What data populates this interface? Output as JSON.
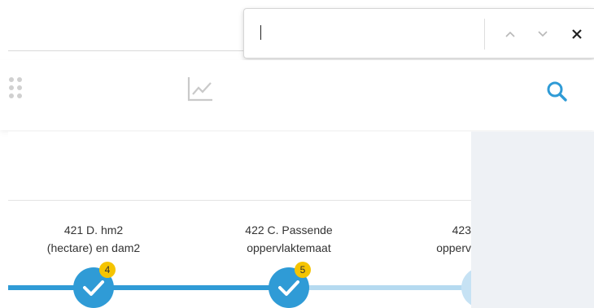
{
  "find_bar": {
    "value": "",
    "icons": {
      "prev": "chevron-up-icon",
      "next": "chevron-down-icon",
      "close": "close-icon"
    }
  },
  "toolbar": {
    "icons": [
      "apps-grid-icon",
      "line-chart-icon",
      "search-icon"
    ],
    "accent_color": "#2f9bd6"
  },
  "steps": [
    {
      "label_line1": "421 D. hm2",
      "label_line2": "(hectare) en dam2",
      "badge": "4",
      "status": "completed"
    },
    {
      "label_line1": "422 C. Passende",
      "label_line2": "oppervlaktemaat",
      "badge": "5",
      "status": "completed"
    },
    {
      "label_line1": "423",
      "label_line2": "opperv",
      "badge": "",
      "status": "pending"
    }
  ],
  "colors": {
    "progress_done": "#2f9bd6",
    "progress_todo": "#b5daf0",
    "badge": "#f5c400",
    "side_panel": "#eef1f5"
  }
}
